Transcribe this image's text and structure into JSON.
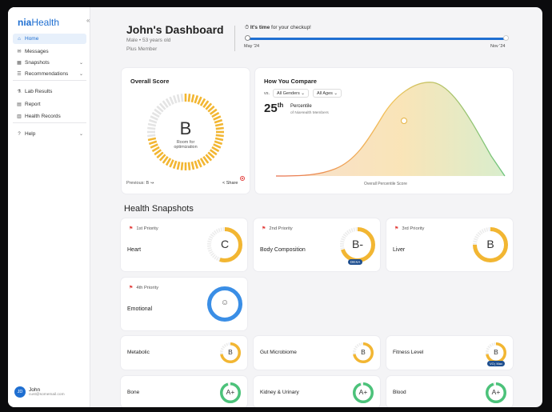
{
  "app": {
    "logo_brand": "nia",
    "logo_rest": "Health",
    "collapse_label": "«"
  },
  "sidebar": {
    "items": [
      {
        "label": "Home",
        "icon": "home-icon",
        "glyph": "⌂",
        "active": true,
        "chevron": false
      },
      {
        "label": "Messages",
        "icon": "message-icon",
        "glyph": "✉",
        "active": false,
        "chevron": false
      },
      {
        "label": "Snapshots",
        "icon": "snapshot-icon",
        "glyph": "▦",
        "active": false,
        "chevron": true
      },
      {
        "label": "Recommendations",
        "icon": "recommendation-icon",
        "glyph": "☰",
        "active": false,
        "chevron": true
      },
      {
        "label": "Lab Results",
        "icon": "lab-icon",
        "glyph": "⚗",
        "active": false,
        "chevron": false
      },
      {
        "label": "Report",
        "icon": "report-icon",
        "glyph": "▤",
        "active": false,
        "chevron": false
      },
      {
        "label": "Health Records",
        "icon": "records-icon",
        "glyph": "▥",
        "active": false,
        "chevron": false
      },
      {
        "label": "Help",
        "icon": "help-icon",
        "glyph": "?",
        "active": false,
        "chevron": true
      }
    ],
    "user": {
      "initials": "JD",
      "name": "John",
      "email": "cust@somemail.com"
    }
  },
  "header": {
    "title": "John's Dashboard",
    "demographics": "Male • 53 years old",
    "plan": "Plus Member",
    "checkup_bold": "It's time",
    "checkup_rest": " for your checkup!",
    "progress_fraction": 0.99,
    "start_label": "May '24",
    "end_label": "Nov '24"
  },
  "overall": {
    "title": "Overall Score",
    "grade": "B",
    "caption": "Room for optimization",
    "fill_fraction": 0.72,
    "previous": "Previous: B",
    "share": "Share"
  },
  "compare": {
    "title": "How You Compare",
    "vs_label": "vs.",
    "gender_select": "All Genders",
    "age_select": "All Ages",
    "percentile_value": "25",
    "percentile_suffix": "th",
    "percentile_label": "Percentile",
    "percentile_sub": "of NiaHealth Members",
    "xlabel": "Overall Percentile Score",
    "marker_fraction": 0.5
  },
  "snapshots": {
    "section_title": "Health Snapshots",
    "priority": [
      {
        "priority": "1st Priority",
        "name": "Heart",
        "grade": "C",
        "fill": 0.55,
        "color": "#f2b632",
        "badge": ""
      },
      {
        "priority": "2nd Priority",
        "name": "Body Composition",
        "grade": "B-",
        "fill": 0.7,
        "color": "#f2b632",
        "badge": "DEXA"
      },
      {
        "priority": "3rd Priority",
        "name": "Liver",
        "grade": "B",
        "fill": 0.75,
        "color": "#f2b632",
        "badge": ""
      },
      {
        "priority": "4th Priority",
        "name": "Emotional",
        "grade": "",
        "fill": 1.0,
        "color": "#3a8ee6",
        "badge": ""
      }
    ],
    "others": [
      {
        "name": "Metabolic",
        "grade": "B",
        "fill": 0.72,
        "color": "#f2b632",
        "badge": ""
      },
      {
        "name": "Gut Microbiome",
        "grade": "B",
        "fill": 0.72,
        "color": "#f2b632",
        "badge": ""
      },
      {
        "name": "Fitness Level",
        "grade": "B",
        "fill": 0.72,
        "color": "#f2b632",
        "badge": "VO₂ Max"
      },
      {
        "name": "Bone",
        "grade": "A+",
        "fill": 0.95,
        "color": "#4cc27a",
        "badge": ""
      },
      {
        "name": "Kidney & Urinary",
        "grade": "A+",
        "fill": 0.95,
        "color": "#4cc27a",
        "badge": ""
      },
      {
        "name": "Blood",
        "grade": "A+",
        "fill": 0.95,
        "color": "#4cc27a",
        "badge": ""
      }
    ]
  }
}
